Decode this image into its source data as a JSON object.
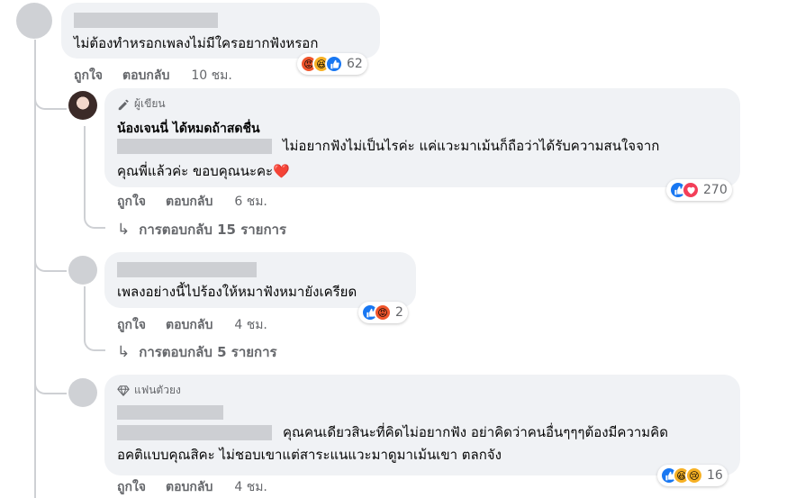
{
  "comments": [
    {
      "text": "ไม่ต้องทำหรอกเพลงไม่มีใครอยากฟังหรอก",
      "like_label": "ถูกใจ",
      "reply_label": "ตอบกลับ",
      "time": "10 ชม.",
      "reactions": [
        "angry",
        "haha",
        "like"
      ],
      "reaction_count": "62"
    },
    {
      "badge": "ผู้เขียน",
      "author": "น้องเจนนี่ ได้หมดถ้าสดชื่น",
      "text_line1": "ไม่อยากฟังไม่เป็นไรค่ะ แค่แวะมาเม้นก็ถือว่าได้รับความสนใจจาก",
      "text_line2": "คุณพี่แล้วค่ะ ขอบคุณนะคะ❤️",
      "like_label": "ถูกใจ",
      "reply_label": "ตอบกลับ",
      "time": "6 ชม.",
      "reactions": [
        "like",
        "love"
      ],
      "reaction_count": "270",
      "replies_link": "การตอบกลับ 15 รายการ"
    },
    {
      "text": "เพลงอย่างนี้ไปร้องให้หมาฟังหมายังเครียด",
      "like_label": "ถูกใจ",
      "reply_label": "ตอบกลับ",
      "time": "4 ชม.",
      "reactions": [
        "like",
        "angry"
      ],
      "reaction_count": "2",
      "replies_link": "การตอบกลับ 5 รายการ"
    },
    {
      "badge": "แฟนตัวยง",
      "text_line1": "คุณคนเดียวสินะที่คิดไม่อยากฟัง อย่าคิดว่าคนอื่นๆๆๆต้องมีความคิด",
      "text_line2": "อคติแบบคุณสิคะ ไม่ชอบเขาแต่สาระแนแวะมาดูมาเม้นเขา ตลกจัง",
      "like_label": "ถูกใจ",
      "reply_label": "ตอบกลับ",
      "time": "4 ชม.",
      "reactions": [
        "like",
        "haha",
        "sad"
      ],
      "reaction_count": "16"
    }
  ],
  "colors": {
    "bubble": "#f0f2f5",
    "redacted": "#cdcfd3",
    "meta_text": "#65676b",
    "like": "#1877f2",
    "love": "#f33e58",
    "angry": "#f0552c",
    "haha": "#f7b125"
  }
}
